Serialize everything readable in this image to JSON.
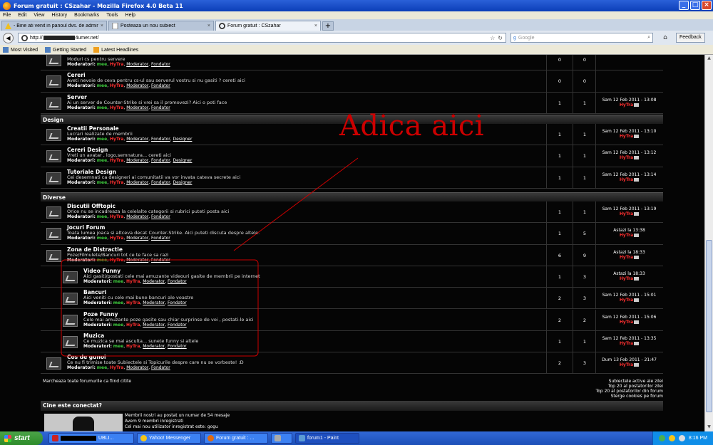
{
  "window": {
    "title": "Forum gratuit : CSzahar - Mozilla Firefox 4.0 Beta 11"
  },
  "menu": [
    "File",
    "Edit",
    "View",
    "History",
    "Bookmarks",
    "Tools",
    "Help"
  ],
  "tabs": [
    {
      "label": "- Bine ati venit in panoul dvs. de adminis...",
      "active": false
    },
    {
      "label": "Posteaza un nou subiect",
      "active": false
    },
    {
      "label": "Forum gratuit : CSzahar",
      "active": true
    }
  ],
  "nav": {
    "url_prefix": "http://",
    "url_suffix": "4umer.net/",
    "search_placeholder": "Google",
    "feedback_label": "Feedback"
  },
  "bookmarks": [
    "Most Visited",
    "Getting Started",
    "Latest Headlines"
  ],
  "forum": {
    "mod_label": "Moderatori:",
    "mod_names": [
      "mee",
      "HyTra",
      "Moderator",
      "Fondator",
      "Designer"
    ],
    "rows_top": [
      {
        "title": "",
        "desc": "Moduri cs pentru servere",
        "mods": 4,
        "topics": "0",
        "posts": "0",
        "last_date": "",
        "last_user": ""
      },
      {
        "title": "Cereri",
        "desc": "Aveti nevoie de ceva pentru cs-ul sau serverul vostru si nu gasiti ? cereti aici",
        "mods": 4,
        "topics": "0",
        "posts": "0",
        "last_date": "",
        "last_user": ""
      },
      {
        "title": "Server",
        "desc": "Ai un server de Counter-Strike si vrei sa il promovezi? Aici o poti face",
        "mods": 4,
        "topics": "1",
        "posts": "1",
        "last_date": "Sam 12 Feb 2011 - 13:08",
        "last_user": "HyTra"
      }
    ],
    "cat_design": "Design",
    "rows_design": [
      {
        "title": "Creatii Personale",
        "desc": "Lucrari realizate de membrii",
        "mods": 5,
        "topics": "1",
        "posts": "1",
        "last_date": "Sam 12 Feb 2011 - 13:10",
        "last_user": "HyTra"
      },
      {
        "title": "Cereri Design",
        "desc": "Vreti un avatar , logo,semnatura... cereti aici",
        "mods": 5,
        "topics": "1",
        "posts": "1",
        "last_date": "Sam 12 Feb 2011 - 13:12",
        "last_user": "HyTra"
      },
      {
        "title": "Tutoriale Design",
        "desc": "Cei desemnati ca designeri ai comunitatii va vor invata cateva secrete aici",
        "mods": 5,
        "topics": "1",
        "posts": "1",
        "last_date": "Sam 12 Feb 2011 - 13:14",
        "last_user": "HyTra"
      }
    ],
    "cat_diverse": "Diverse",
    "rows_diverse": [
      {
        "title": "Discutii Offtopic",
        "desc": "Orice nu se incadreaza la celelalte categorii si rubrici puteti posta aici",
        "mods": 4,
        "topics": "1",
        "posts": "1",
        "last_date": "Sam 12 Feb 2011 - 13:19",
        "last_user": "HyTra"
      },
      {
        "title": "Jocuri Forum",
        "desc": "Toata lumea joaca si altceva decat Counter-Strike. Aici puteti discuta despre altele.",
        "mods": 4,
        "topics": "1",
        "posts": "5",
        "last_date": "Astazi la 13:38",
        "last_user": "HyTra"
      },
      {
        "title": "Zona de Distractie",
        "desc": "Poze/Filmulete/Bancuri tot ce te face sa razi",
        "mods": 4,
        "topics": "6",
        "posts": "9",
        "last_date": "Astazi la 18:33",
        "last_user": "HyTra"
      }
    ],
    "rows_sub": [
      {
        "title": "Video Funny",
        "desc": "Aici gasiti/postati cele mai amuzante videouri gasite de membrii pe internet",
        "mods": 4,
        "topics": "1",
        "posts": "3",
        "last_date": "Astazi la 18:33",
        "last_user": "HyTra"
      },
      {
        "title": "Bancuri",
        "desc": "Aici veniti cu cele mai bune bancuri ale voastre",
        "mods": 4,
        "topics": "2",
        "posts": "3",
        "last_date": "Sam 12 Feb 2011 - 15:01",
        "last_user": "HyTra"
      },
      {
        "title": "Poze Funny",
        "desc": "Cele mai amuzante poze gasite sau chiar surprinse de voi , postati-le aici",
        "mods": 4,
        "topics": "2",
        "posts": "2",
        "last_date": "Sam 12 Feb 2011 - 15:06",
        "last_user": "HyTra"
      },
      {
        "title": "Muzica",
        "desc": "Ce muzica se mai asculta... sunete funny si altele",
        "mods": 4,
        "topics": "1",
        "posts": "1",
        "last_date": "Sam 12 Feb 2011 - 13:35",
        "last_user": "HyTra"
      }
    ],
    "rows_after": [
      {
        "title": "Cos de gunoi",
        "desc": "Ce nu fi trimise toate Subiectele si Topicurile despre care nu se vorbeste! :D",
        "mods": 4,
        "topics": "2",
        "posts": "3",
        "last_date": "Dum 13 Feb 2011 - 21:47",
        "last_user": "HyTra"
      }
    ],
    "mark_read": "Marcheaza toate forumurile ca fiind citite",
    "footer_links": [
      "Subiectele active ale zilei",
      "Top 20 al postatorilor zilei",
      "Top 20 al postatorilor din forum",
      "Sterge cookies pe forum"
    ],
    "who_title": "Cine este conectat?",
    "who_lines": [
      "Membrii nostri au postat un numar de 54 mesaje",
      "Avem 9 membri inregistrati",
      "Cel mai nou utilizator inregistrat este: gogu"
    ]
  },
  "annotation": "Adica aici",
  "annotation_color": "#cc0000",
  "taskbar": {
    "start_label": "start",
    "items": [
      {
        "label": "UBLI...",
        "active": false
      },
      {
        "label": "Yahoo! Messenger",
        "active": false
      },
      {
        "label": "Forum gratuit : ...",
        "active": false
      },
      {
        "label": "",
        "active": false
      },
      {
        "label": "forum1 - Paint",
        "active": true
      }
    ],
    "clock": "8:16 PM"
  }
}
